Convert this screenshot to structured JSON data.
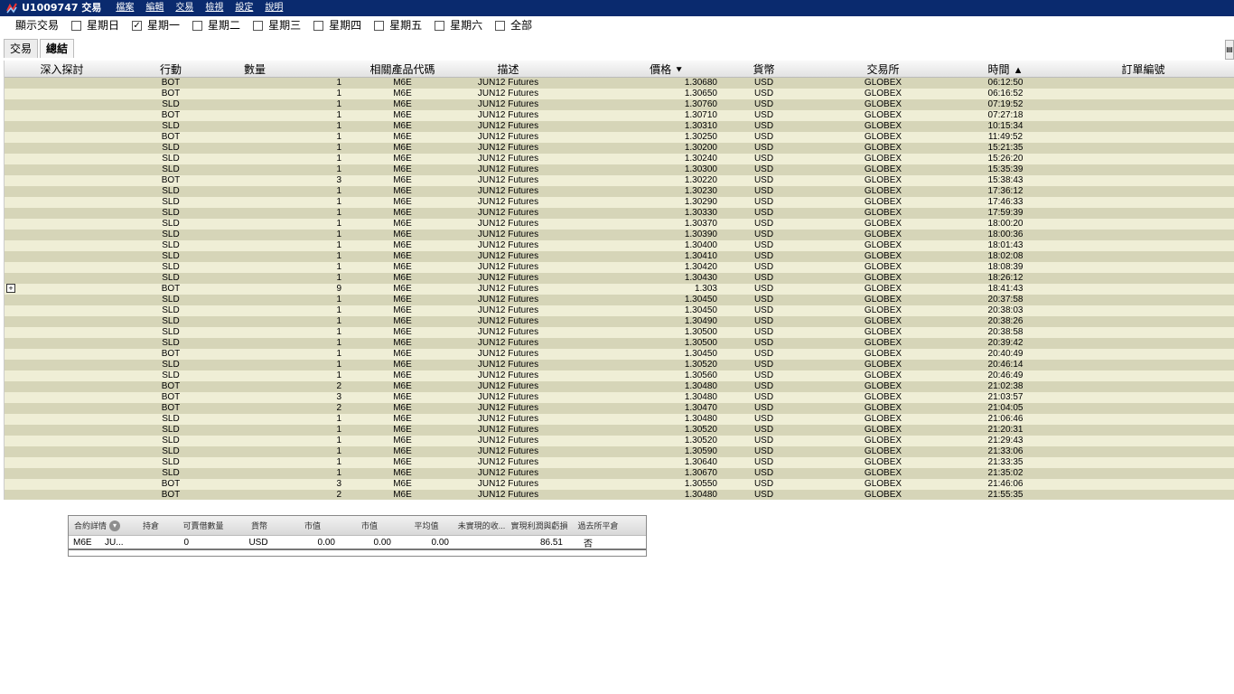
{
  "window": {
    "title": "U1009747 交易",
    "menu": [
      "檔案",
      "編輯",
      "交易",
      "檢視",
      "設定",
      "說明"
    ]
  },
  "filter": {
    "label": "顯示交易",
    "days": [
      {
        "label": "星期日",
        "checked": false
      },
      {
        "label": "星期一",
        "checked": true
      },
      {
        "label": "星期二",
        "checked": false
      },
      {
        "label": "星期三",
        "checked": false
      },
      {
        "label": "星期四",
        "checked": false
      },
      {
        "label": "星期五",
        "checked": false
      },
      {
        "label": "星期六",
        "checked": false
      },
      {
        "label": "全部",
        "checked": false
      }
    ]
  },
  "tabs": [
    {
      "label": "交易",
      "active": false
    },
    {
      "label": "總結",
      "active": true
    }
  ],
  "table": {
    "columns": [
      "深入探討",
      "行動",
      "數量",
      "相關產品代碼",
      "描述",
      "價格",
      "貨幣",
      "交易所",
      "時間",
      "訂單編號"
    ],
    "sort": {
      "價格": "desc",
      "時間": "asc"
    },
    "rows": [
      [
        "",
        "BOT",
        "1",
        "M6E",
        "JUN12 Futures",
        "1.30680",
        "USD",
        "GLOBEX",
        "06:12:50",
        ""
      ],
      [
        "",
        "BOT",
        "1",
        "M6E",
        "JUN12 Futures",
        "1.30650",
        "USD",
        "GLOBEX",
        "06:16:52",
        ""
      ],
      [
        "",
        "SLD",
        "1",
        "M6E",
        "JUN12 Futures",
        "1.30760",
        "USD",
        "GLOBEX",
        "07:19:52",
        ""
      ],
      [
        "",
        "BOT",
        "1",
        "M6E",
        "JUN12 Futures",
        "1.30710",
        "USD",
        "GLOBEX",
        "07:27:18",
        ""
      ],
      [
        "",
        "SLD",
        "1",
        "M6E",
        "JUN12 Futures",
        "1.30310",
        "USD",
        "GLOBEX",
        "10:15:34",
        ""
      ],
      [
        "",
        "BOT",
        "1",
        "M6E",
        "JUN12 Futures",
        "1.30250",
        "USD",
        "GLOBEX",
        "11:49:52",
        ""
      ],
      [
        "",
        "SLD",
        "1",
        "M6E",
        "JUN12 Futures",
        "1.30200",
        "USD",
        "GLOBEX",
        "15:21:35",
        ""
      ],
      [
        "",
        "SLD",
        "1",
        "M6E",
        "JUN12 Futures",
        "1.30240",
        "USD",
        "GLOBEX",
        "15:26:20",
        ""
      ],
      [
        "",
        "SLD",
        "1",
        "M6E",
        "JUN12 Futures",
        "1.30300",
        "USD",
        "GLOBEX",
        "15:35:39",
        ""
      ],
      [
        "",
        "BOT",
        "3",
        "M6E",
        "JUN12 Futures",
        "1.30220",
        "USD",
        "GLOBEX",
        "15:38:43",
        ""
      ],
      [
        "",
        "SLD",
        "1",
        "M6E",
        "JUN12 Futures",
        "1.30230",
        "USD",
        "GLOBEX",
        "17:36:12",
        ""
      ],
      [
        "",
        "SLD",
        "1",
        "M6E",
        "JUN12 Futures",
        "1.30290",
        "USD",
        "GLOBEX",
        "17:46:33",
        ""
      ],
      [
        "",
        "SLD",
        "1",
        "M6E",
        "JUN12 Futures",
        "1.30330",
        "USD",
        "GLOBEX",
        "17:59:39",
        ""
      ],
      [
        "",
        "SLD",
        "1",
        "M6E",
        "JUN12 Futures",
        "1.30370",
        "USD",
        "GLOBEX",
        "18:00:20",
        ""
      ],
      [
        "",
        "SLD",
        "1",
        "M6E",
        "JUN12 Futures",
        "1.30390",
        "USD",
        "GLOBEX",
        "18:00:36",
        ""
      ],
      [
        "",
        "SLD",
        "1",
        "M6E",
        "JUN12 Futures",
        "1.30400",
        "USD",
        "GLOBEX",
        "18:01:43",
        ""
      ],
      [
        "",
        "SLD",
        "1",
        "M6E",
        "JUN12 Futures",
        "1.30410",
        "USD",
        "GLOBEX",
        "18:02:08",
        ""
      ],
      [
        "",
        "SLD",
        "1",
        "M6E",
        "JUN12 Futures",
        "1.30420",
        "USD",
        "GLOBEX",
        "18:08:39",
        ""
      ],
      [
        "",
        "SLD",
        "1",
        "M6E",
        "JUN12 Futures",
        "1.30430",
        "USD",
        "GLOBEX",
        "18:26:12",
        ""
      ],
      [
        "+",
        "BOT",
        "9",
        "M6E",
        "JUN12 Futures",
        "1.303",
        "USD",
        "GLOBEX",
        "18:41:43",
        ""
      ],
      [
        "",
        "SLD",
        "1",
        "M6E",
        "JUN12 Futures",
        "1.30450",
        "USD",
        "GLOBEX",
        "20:37:58",
        ""
      ],
      [
        "",
        "SLD",
        "1",
        "M6E",
        "JUN12 Futures",
        "1.30450",
        "USD",
        "GLOBEX",
        "20:38:03",
        ""
      ],
      [
        "",
        "SLD",
        "1",
        "M6E",
        "JUN12 Futures",
        "1.30490",
        "USD",
        "GLOBEX",
        "20:38:26",
        ""
      ],
      [
        "",
        "SLD",
        "1",
        "M6E",
        "JUN12 Futures",
        "1.30500",
        "USD",
        "GLOBEX",
        "20:38:58",
        ""
      ],
      [
        "",
        "SLD",
        "1",
        "M6E",
        "JUN12 Futures",
        "1.30500",
        "USD",
        "GLOBEX",
        "20:39:42",
        ""
      ],
      [
        "",
        "BOT",
        "1",
        "M6E",
        "JUN12 Futures",
        "1.30450",
        "USD",
        "GLOBEX",
        "20:40:49",
        ""
      ],
      [
        "",
        "SLD",
        "1",
        "M6E",
        "JUN12 Futures",
        "1.30520",
        "USD",
        "GLOBEX",
        "20:46:14",
        ""
      ],
      [
        "",
        "SLD",
        "1",
        "M6E",
        "JUN12 Futures",
        "1.30560",
        "USD",
        "GLOBEX",
        "20:46:49",
        ""
      ],
      [
        "",
        "BOT",
        "2",
        "M6E",
        "JUN12 Futures",
        "1.30480",
        "USD",
        "GLOBEX",
        "21:02:38",
        ""
      ],
      [
        "",
        "BOT",
        "3",
        "M6E",
        "JUN12 Futures",
        "1.30480",
        "USD",
        "GLOBEX",
        "21:03:57",
        ""
      ],
      [
        "",
        "BOT",
        "2",
        "M6E",
        "JUN12 Futures",
        "1.30470",
        "USD",
        "GLOBEX",
        "21:04:05",
        ""
      ],
      [
        "",
        "SLD",
        "1",
        "M6E",
        "JUN12 Futures",
        "1.30480",
        "USD",
        "GLOBEX",
        "21:06:46",
        ""
      ],
      [
        "",
        "SLD",
        "1",
        "M6E",
        "JUN12 Futures",
        "1.30520",
        "USD",
        "GLOBEX",
        "21:20:31",
        ""
      ],
      [
        "",
        "SLD",
        "1",
        "M6E",
        "JUN12 Futures",
        "1.30520",
        "USD",
        "GLOBEX",
        "21:29:43",
        ""
      ],
      [
        "",
        "SLD",
        "1",
        "M6E",
        "JUN12 Futures",
        "1.30590",
        "USD",
        "GLOBEX",
        "21:33:06",
        ""
      ],
      [
        "",
        "SLD",
        "1",
        "M6E",
        "JUN12 Futures",
        "1.30640",
        "USD",
        "GLOBEX",
        "21:33:35",
        ""
      ],
      [
        "",
        "SLD",
        "1",
        "M6E",
        "JUN12 Futures",
        "1.30670",
        "USD",
        "GLOBEX",
        "21:35:02",
        ""
      ],
      [
        "",
        "BOT",
        "3",
        "M6E",
        "JUN12 Futures",
        "1.30550",
        "USD",
        "GLOBEX",
        "21:46:06",
        ""
      ],
      [
        "",
        "BOT",
        "2",
        "M6E",
        "JUN12 Futures",
        "1.30480",
        "USD",
        "GLOBEX",
        "21:55:35",
        ""
      ]
    ]
  },
  "portfolio": {
    "columns": [
      "合約詳情",
      "持倉",
      "可賣借數量",
      "貨幣",
      "市值",
      "市值",
      "平均值",
      "未實現的收...",
      "實現利潤與虧損",
      "過去所平倉"
    ],
    "row": [
      "M6E",
      "JU...",
      "0",
      "",
      "USD",
      "0.00",
      "0.00",
      "0.00",
      "",
      "86.51",
      "否"
    ]
  },
  "colors": {
    "titlebar": "#0a2a6e",
    "row_odd": "#d6d5b8",
    "row_even": "#efeed6"
  }
}
